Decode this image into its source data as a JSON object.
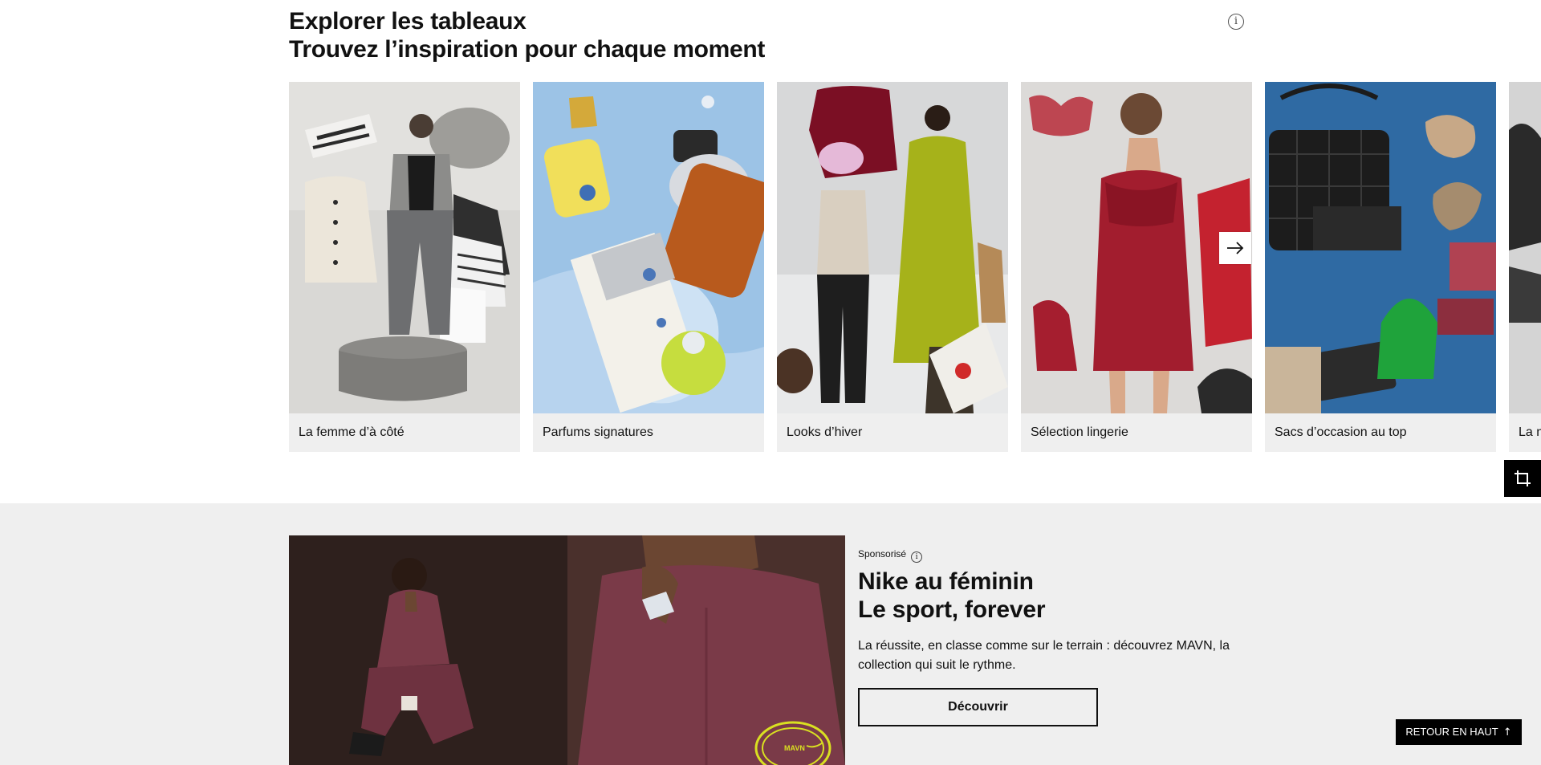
{
  "boards": {
    "title_line1": "Explorer les tableaux",
    "title_line2": "Trouvez l’inspiration pour chaque moment",
    "info_icon": "info-icon",
    "cards": [
      {
        "label": "La femme d’à côté"
      },
      {
        "label": "Parfums signatures"
      },
      {
        "label": "Looks d’hiver"
      },
      {
        "label": "Sélection lingerie"
      },
      {
        "label": "Sacs d’occasion au top"
      },
      {
        "label": "La n"
      }
    ],
    "next_icon": "arrow-right-icon",
    "crop_icon": "crop-icon"
  },
  "promo": {
    "sponsored_label": "Sponsorisé",
    "title_line1": "Nike au féminin",
    "title_line2": "Le sport, forever",
    "text": "La réussite, en classe comme sur le terrain : découvrez MAVN, la collection qui suit le rythme.",
    "cta_label": "Découvrir",
    "badge_text": "MAVN"
  },
  "back_to_top": {
    "label": "RETOUR EN HAUT",
    "icon": "arrow-up-icon"
  },
  "colors": {
    "section_bg": "#efefef",
    "card_bg": "#efefef",
    "text": "#111111",
    "black": "#000000"
  }
}
